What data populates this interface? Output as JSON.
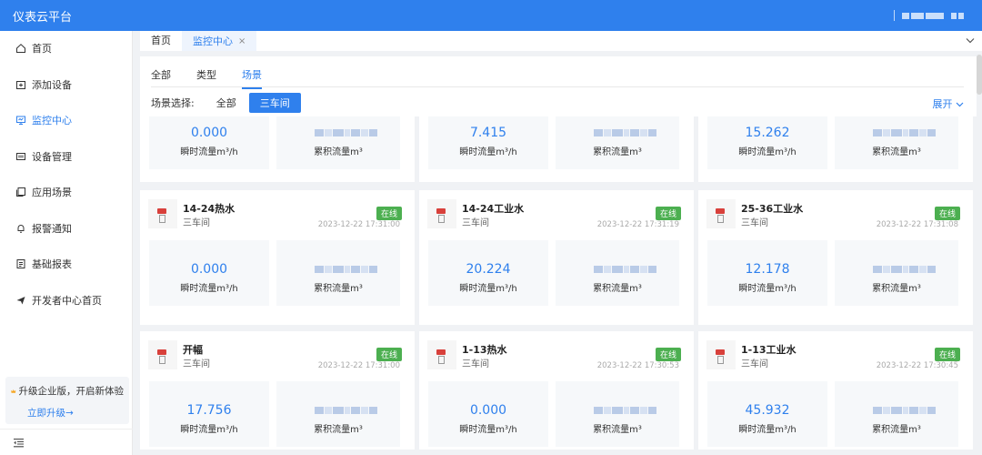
{
  "app": {
    "title": "仪表云平台"
  },
  "sidebar": {
    "items": [
      {
        "label": "首页",
        "icon": "home-icon"
      },
      {
        "label": "添加设备",
        "icon": "add-device-icon"
      },
      {
        "label": "监控中心",
        "icon": "monitor-icon",
        "active": true
      },
      {
        "label": "设备管理",
        "icon": "device-manage-icon"
      },
      {
        "label": "应用场景",
        "icon": "scene-icon"
      },
      {
        "label": "报警通知",
        "icon": "bell-icon"
      },
      {
        "label": "基础报表",
        "icon": "report-icon"
      },
      {
        "label": "开发者中心首页",
        "icon": "send-icon"
      }
    ],
    "upgrade_text": "升级企业版，开启新体验",
    "upgrade_link": "立即升级→"
  },
  "tabs": {
    "home": "首页",
    "current": "监控中心",
    "close": "×"
  },
  "filter": {
    "tabs": [
      "全部",
      "类型",
      "场景"
    ],
    "scene_label": "场景选择:",
    "scene_options": [
      "全部",
      "三车间"
    ],
    "expand": "展开"
  },
  "metric_label": "瞬时流量m³/h",
  "total_label": "累积流量m³",
  "status_online": "在线",
  "colors": {
    "accent": "#2f80ed",
    "online": "#4caf50"
  },
  "cards": [
    {
      "name": "",
      "location": "",
      "time": "",
      "flow": "0.000"
    },
    {
      "name": "",
      "location": "",
      "time": "",
      "flow": "7.415"
    },
    {
      "name": "",
      "location": "",
      "time": "",
      "flow": "15.262"
    },
    {
      "name": "14-24热水",
      "location": "三车间",
      "time": "2023-12-22 17:31:00",
      "flow": "0.000"
    },
    {
      "name": "14-24工业水",
      "location": "三车间",
      "time": "2023-12-22 17:31:19",
      "flow": "20.224"
    },
    {
      "name": "25-36工业水",
      "location": "三车间",
      "time": "2023-12-22 17:31:08",
      "flow": "12.178"
    },
    {
      "name": "开幅",
      "location": "三车间",
      "time": "2023-12-22 17:31:00",
      "flow": "17.756"
    },
    {
      "name": "1-13热水",
      "location": "三车间",
      "time": "2023-12-22 17:30:53",
      "flow": "0.000"
    },
    {
      "name": "1-13工业水",
      "location": "三车间",
      "time": "2023-12-22 17:30:45",
      "flow": "45.932"
    }
  ]
}
